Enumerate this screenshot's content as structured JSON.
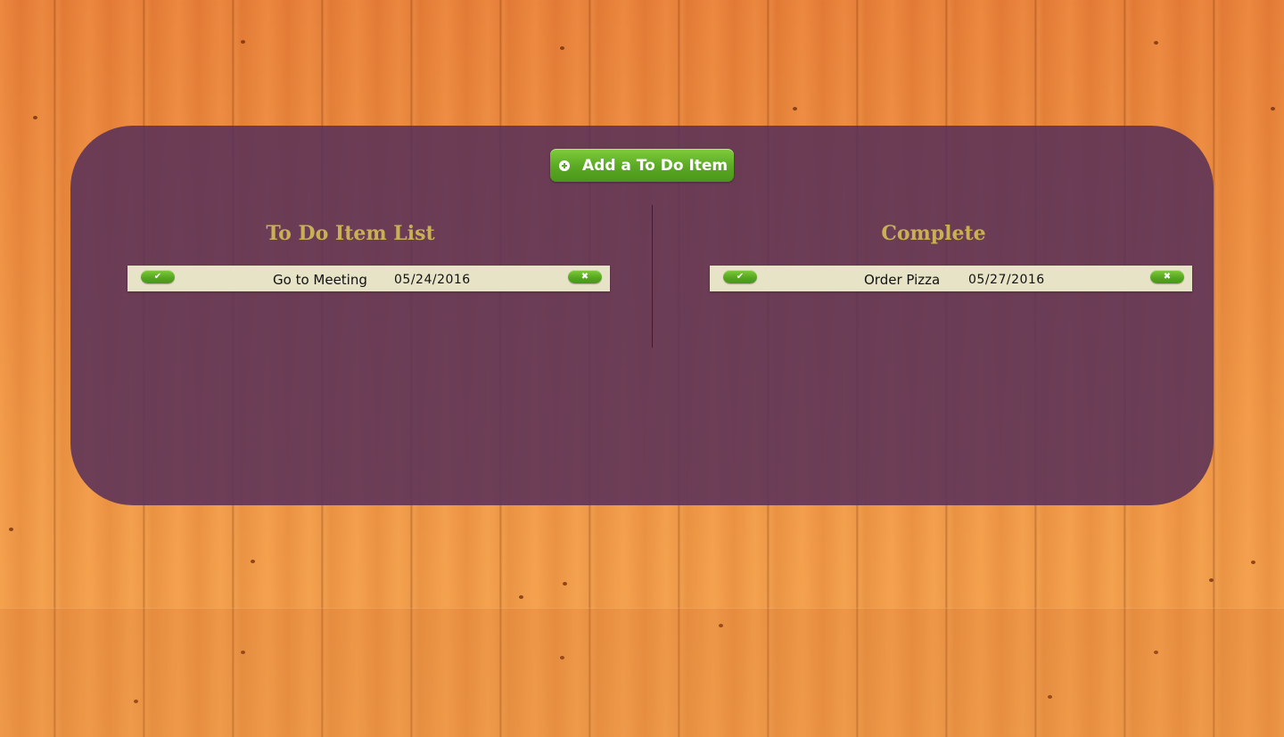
{
  "toolbar": {
    "add_label": "Add a To Do Item",
    "add_icon": "plus-circle-icon"
  },
  "lists": {
    "todo": {
      "title": "To Do Item List",
      "items": [
        {
          "text": "Go to Meeting",
          "date": "05/24/2016",
          "complete_icon": "✔",
          "delete_icon": "✖"
        }
      ]
    },
    "complete": {
      "title": "Complete",
      "items": [
        {
          "text": "Order Pizza",
          "date": "05/27/2016",
          "complete_icon": "✔",
          "delete_icon": "✖"
        }
      ]
    }
  },
  "colors": {
    "background_wood": "#e8873a",
    "panel": "#583058",
    "title_gold": "#c9b055",
    "button_green": "#5aa823",
    "item_row": "#e7e3c7"
  }
}
